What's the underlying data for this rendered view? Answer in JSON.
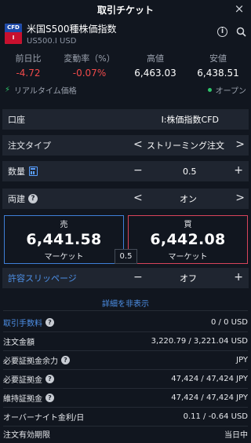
{
  "header": {
    "title": "取引チケット",
    "close_icon": "×"
  },
  "symbol": {
    "logo_top": "CFD",
    "logo_bottom": "I",
    "name": "米国S500種株価指数",
    "code": "US500.I USD"
  },
  "stats": [
    {
      "label": "前日比",
      "value": "-4.72"
    },
    {
      "label": "変動率（%）",
      "value": "-0.07%"
    },
    {
      "label": "高値",
      "value": "6,463.03"
    },
    {
      "label": "安値",
      "value": "6,438.51"
    }
  ],
  "realtime": {
    "label": "リアルタイム価格",
    "status": "オープン"
  },
  "fields": {
    "account": {
      "label": "口座",
      "value": "I:株価指数CFD"
    },
    "order_type": {
      "label": "注文タイプ",
      "value": "ストリーミング注文"
    },
    "quantity": {
      "label": "数量",
      "value": "0.5"
    },
    "hedge": {
      "label": "両建",
      "value": "オン"
    },
    "slippage": {
      "label": "許容スリッページ",
      "value": "オフ"
    }
  },
  "controls": {
    "minus": "−",
    "plus": "+",
    "left": "<",
    "right": ">"
  },
  "sell": {
    "side": "売",
    "price": "6,441.58",
    "type": "マーケット"
  },
  "buy": {
    "side": "買",
    "price": "6,442.08",
    "type": "マーケット"
  },
  "spread": "0.5",
  "detail_toggle": "詳細を非表示",
  "details": [
    {
      "label": "取引手数料",
      "value": "0 / 0 USD"
    },
    {
      "label": "注文金額",
      "value": "3,220.79 / 3,221.04 USD"
    },
    {
      "label": "必要証拠金余力",
      "value": "JPY"
    },
    {
      "label": "必要証拠金",
      "value": "47,424 / 47,424 JPY"
    },
    {
      "label": "維持証拠金",
      "value": "47,424 / 47,424 JPY"
    },
    {
      "label": "オーバーナイト金利/日",
      "value": "0.11 / -0.64 USD"
    },
    {
      "label": "注文有効期限",
      "value": "当日中"
    }
  ],
  "colors": {
    "negative": "#f04a4a",
    "accent": "#4d8fe6",
    "sell_border": "#3f7fd8",
    "buy_border": "#d8445b",
    "live": "#2ec46a"
  }
}
